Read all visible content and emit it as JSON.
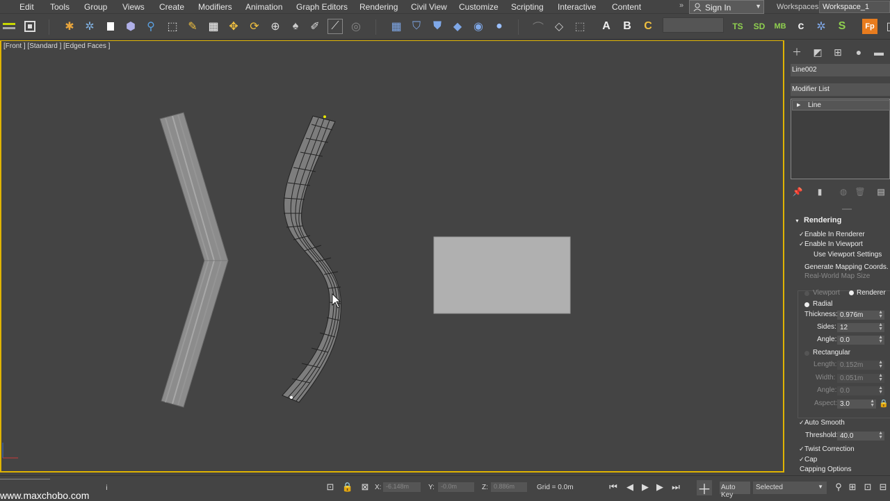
{
  "menu": {
    "items": [
      {
        "label": "Edit",
        "key": "edit"
      },
      {
        "label": "Tools",
        "key": "tools"
      },
      {
        "label": "Group",
        "key": "group"
      },
      {
        "label": "Views",
        "key": "views"
      },
      {
        "label": "Create",
        "key": "create"
      },
      {
        "label": "Modifiers",
        "key": "modifiers"
      },
      {
        "label": "Animation",
        "key": "animation"
      },
      {
        "label": "Graph Editors",
        "key": "graph-editors"
      },
      {
        "label": "Rendering",
        "key": "rendering"
      },
      {
        "label": "Civil View",
        "key": "civil-view"
      },
      {
        "label": "Customize",
        "key": "customize"
      },
      {
        "label": "Scripting",
        "key": "scripting"
      },
      {
        "label": "Interactive",
        "key": "interactive"
      },
      {
        "label": "Content",
        "key": "content"
      }
    ],
    "more": "»",
    "sign_in": "Sign In",
    "workspaces_label": "Workspaces:",
    "workspace_value": "Workspace_1"
  },
  "toolbar": {
    "text_icons": {
      "ts": "TS",
      "sd": "SD",
      "mb": "MB",
      "fp": "Fp"
    }
  },
  "viewport": {
    "label": "[Front ] [Standard ] [Edged Faces ]",
    "accent": "#e0b400"
  },
  "panel": {
    "object_name": "Line002",
    "modifier_list": "Modifier List",
    "stack_item": "Line",
    "rollout_title": "Rendering",
    "enable_in_renderer": "Enable In Renderer",
    "enable_in_viewport": "Enable In Viewport",
    "use_viewport_settings": "Use Viewport Settings",
    "generate_mapping": "Generate Mapping Coords.",
    "real_world_map": "Real-World Map Size",
    "viewport_radio": "Viewport",
    "renderer_radio": "Renderer",
    "radial": "Radial",
    "thickness_label": "Thickness:",
    "thickness_value": "0.976m",
    "sides_label": "Sides:",
    "sides_value": "12",
    "angle_label": "Angle:",
    "angle_value": "0.0",
    "rectangular": "Rectangular",
    "length_label": "Length:",
    "length_value": "0.152m",
    "width_label": "Width:",
    "width_value": "0.051m",
    "angle2_label": "Angle:",
    "angle2_value": "0.0",
    "aspect_label": "Aspect:",
    "aspect_value": "3.0",
    "auto_smooth": "Auto Smooth",
    "threshold_label": "Threshold:",
    "threshold_value": "40.0",
    "twist_correction": "Twist Correction",
    "cap": "Cap",
    "capping_options": "Capping Options"
  },
  "status": {
    "watermark": "www.maxchobo.com",
    "x_label": "X:",
    "x_value": "-6.148m",
    "y_label": "Y:",
    "y_value": "-0.0m",
    "z_label": "Z:",
    "z_value": "0.886m",
    "grid": "Grid = 0.0m",
    "auto_key": "Auto Key",
    "selected": "Selected"
  }
}
